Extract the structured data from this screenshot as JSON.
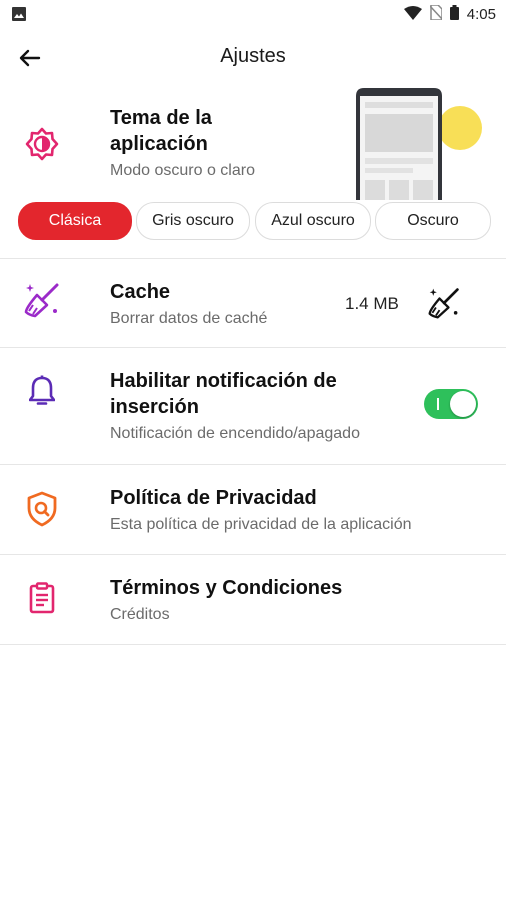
{
  "status_bar": {
    "time": "4:05"
  },
  "header": {
    "title": "Ajustes"
  },
  "theme": {
    "title_line1": "Tema de la",
    "title_line2": "aplicación",
    "subtitle": "Modo oscuro o claro",
    "options": [
      "Clásica",
      "Gris oscuro",
      "Azul oscuro",
      "Oscuro"
    ],
    "selected": "Clásica"
  },
  "cache": {
    "title": "Cache",
    "subtitle": "Borrar datos de caché",
    "size": "1.4 MB"
  },
  "notifications": {
    "title_line1": "Habilitar notificación de",
    "title_line2": "inserción",
    "subtitle": "Notificación de encendido/apagado",
    "enabled": true
  },
  "privacy": {
    "title": "Política de Privacidad",
    "subtitle": "Esta política de privacidad de la aplicación"
  },
  "terms": {
    "title": "Términos y Condiciones",
    "subtitle": "Créditos"
  },
  "colors": {
    "accent_red": "#e3262d",
    "toggle_green": "#2ec05b",
    "cache_purple": "#9b2ac9",
    "bell_purple": "#5b2bb5",
    "shield_orange": "#f06a21",
    "clipboard_pink": "#e2266e"
  }
}
